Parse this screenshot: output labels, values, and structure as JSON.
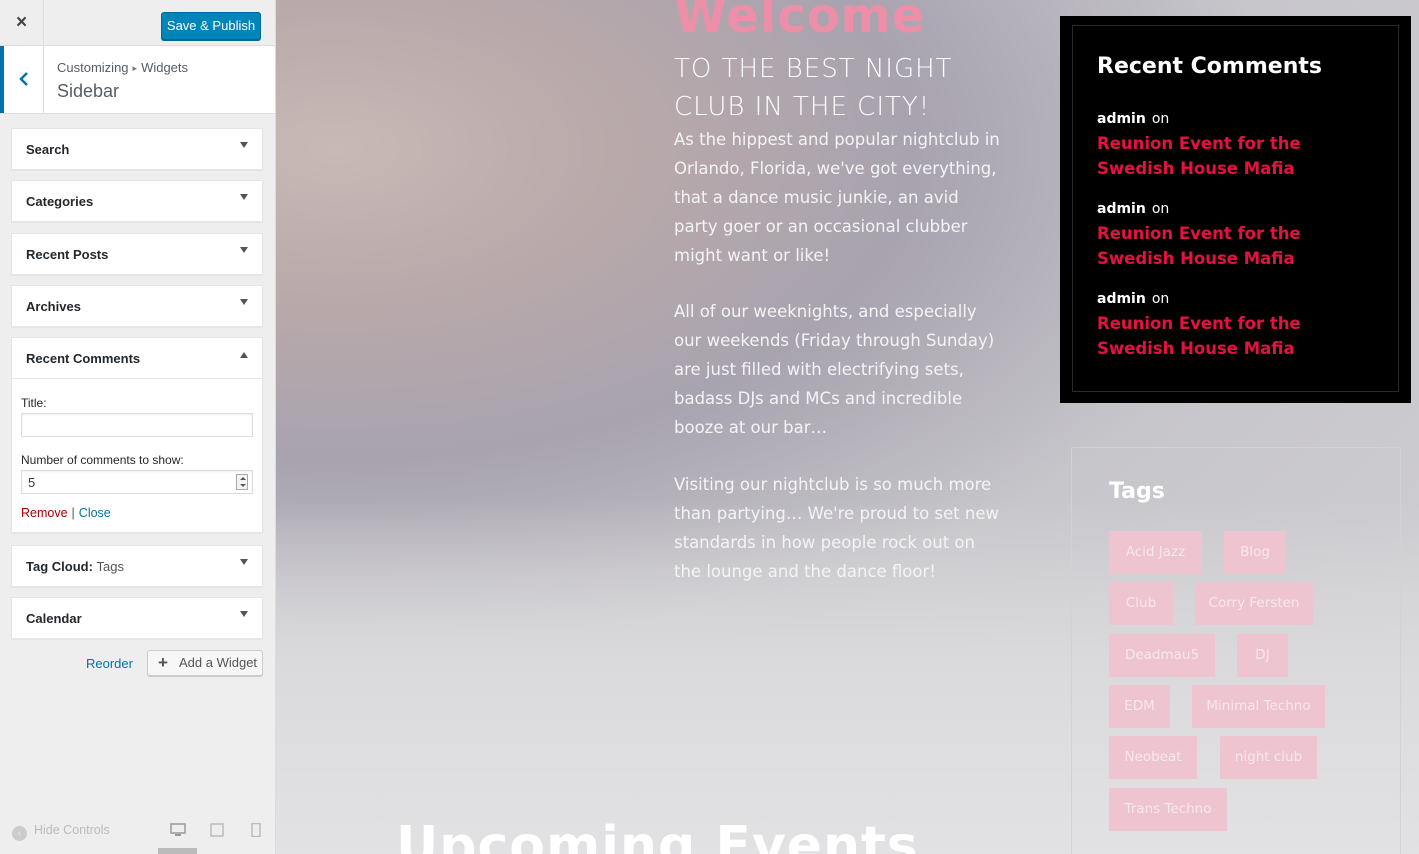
{
  "customizer": {
    "close_label": "×",
    "publish_label": "Save & Publish",
    "breadcrumb": [
      "Customizing",
      "Widgets"
    ],
    "breadcrumb_sep": "▸",
    "section_title": "Sidebar",
    "widgets": {
      "search": "Search",
      "categories": "Categories",
      "recent_posts": "Recent Posts",
      "archives": "Archives",
      "recent_comments": "Recent Comments",
      "tag_cloud_prefix": "Tag Cloud:",
      "tag_cloud_sub": "Tags",
      "calendar": "Calendar"
    },
    "recent_comments_form": {
      "title_label": "Title:",
      "title_value": "",
      "number_label": "Number of comments to show:",
      "number_value": "5",
      "remove_label": "Remove",
      "separator": "|",
      "close_label": "Close"
    },
    "reorder_label": "Reorder",
    "add_widget_label": "Add a Widget",
    "hide_controls_label": "Hide Controls"
  },
  "preview": {
    "welcome": "Welcome",
    "subhead": "TO THE BEST NIGHT CLUB IN THE CITY!",
    "paragraphs": [
      "As the hippest and popular nightclub in Orlando, Florida, we've got everything, that a dance music junkie, an avid party goer or an occasional clubber might want or like!",
      "All of our weeknights, and especially our weekends (Friday through Sunday) are just filled with electrifying sets, badass DJs and MCs and incredible booze at our bar…",
      "Visiting our nightclub is so much more than partying… We're proud to set new standards in how people rock out on the lounge and the dance floor!"
    ],
    "recent_comments": {
      "title": "Recent Comments",
      "items": [
        {
          "author": "admin",
          "on": "on",
          "post": "Reunion Event for the Swedish House Mafia"
        },
        {
          "author": "admin",
          "on": "on",
          "post": "Reunion Event for the Swedish House Mafia"
        },
        {
          "author": "admin",
          "on": "on",
          "post": "Reunion Event for the Swedish House Mafia"
        }
      ]
    },
    "tags": {
      "title": "Tags",
      "items": [
        "Acid Jazz",
        "Blog",
        "Club",
        "Corry Fersten",
        "Deadmau5",
        "DJ",
        "EDM",
        "Minimal Techno",
        "Neobeat",
        "night club",
        "Trans Techno"
      ]
    },
    "upcoming": "Upcoming Events"
  },
  "colors": {
    "primary": "#0085ba",
    "link": "#0073aa",
    "remove": "#aa0000",
    "accent_red": "#e3123f",
    "welcome_pink": "#ee8faa"
  }
}
